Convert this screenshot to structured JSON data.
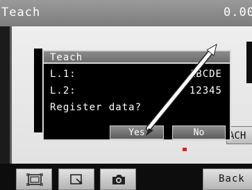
{
  "header": {
    "title": "Teach",
    "value": "0.00"
  },
  "dialog": {
    "title": "Teach",
    "rows": [
      {
        "label": "L.1:",
        "value": "ABCDE"
      },
      {
        "label": "L.2:",
        "value": "12345"
      }
    ],
    "prompt": "Register data?",
    "yes_label": "Yes",
    "no_label": "No"
  },
  "side_button_label": "ACH",
  "toolbar": {
    "buttons": [
      {
        "icon": "frame-icon"
      },
      {
        "icon": "zoom-window-icon"
      },
      {
        "icon": "camera-icon"
      }
    ],
    "back_label": "Back"
  },
  "colors": {
    "accent_red": "#e31d1d",
    "title_gray": "#8a8a8a",
    "dialog_bg": "#000000"
  }
}
